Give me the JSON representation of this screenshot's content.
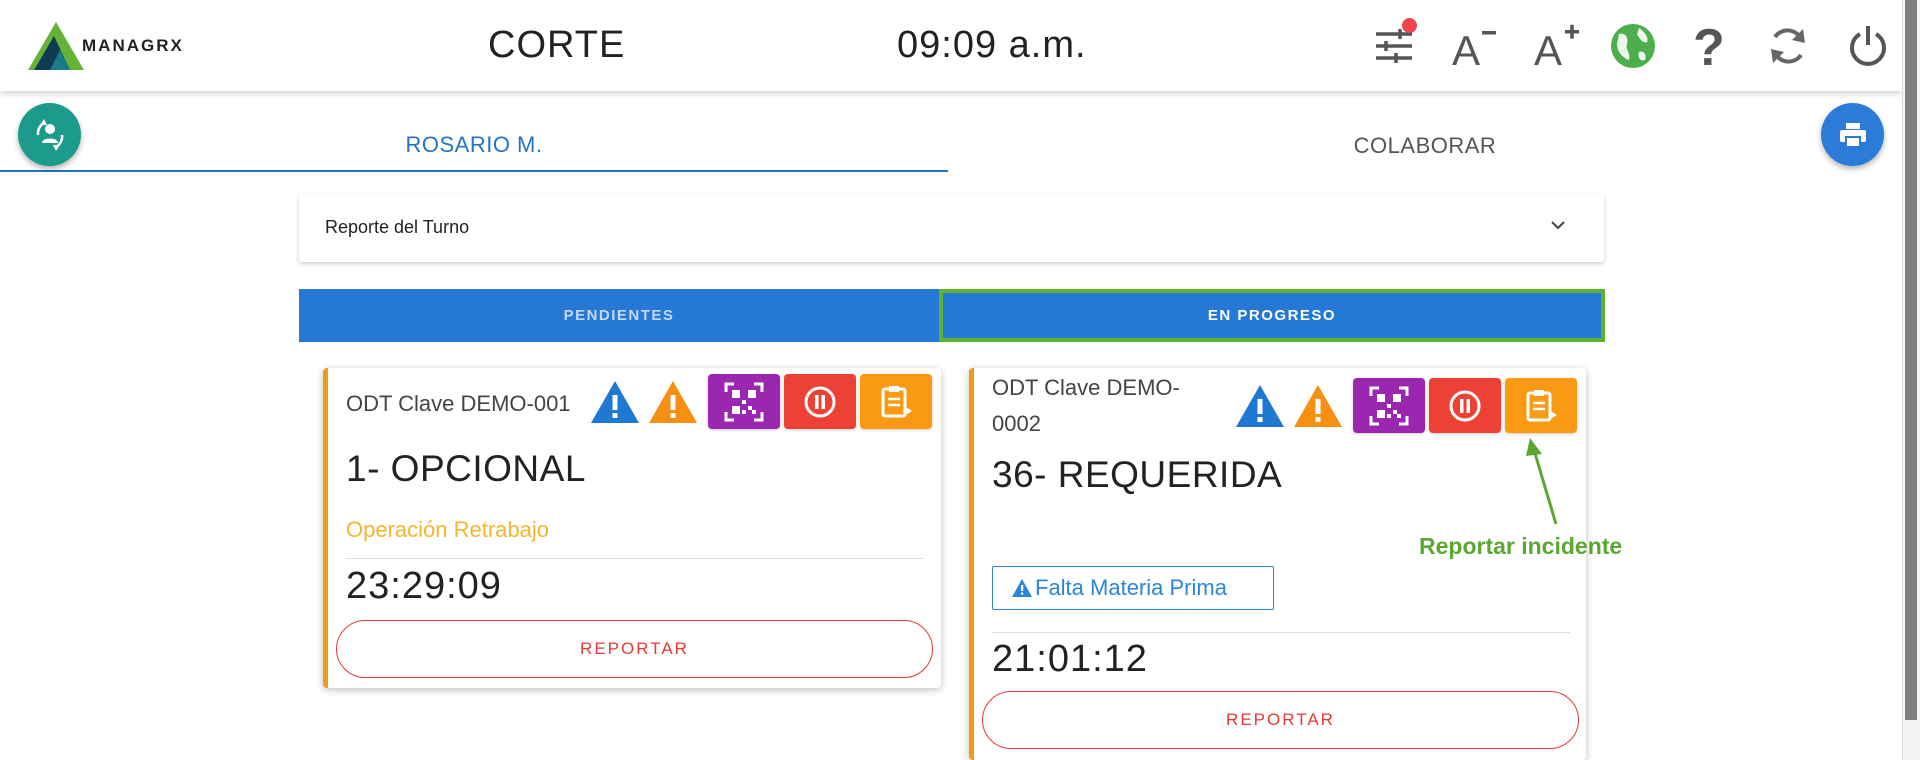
{
  "header": {
    "logo_text": "MANAGRX",
    "station": "CORTE",
    "clock": "09:09 a.m.",
    "icons": [
      "filters-icon",
      "font-decrease-icon",
      "font-increase-icon",
      "globe-icon",
      "help-icon",
      "refresh-icon",
      "power-icon"
    ]
  },
  "operator_tabs": [
    {
      "label": "ROSARIO M.",
      "active": true
    },
    {
      "label": "COLABORAR",
      "active": false
    }
  ],
  "report_panel": {
    "title": "Reporte del Turno"
  },
  "status_tabs": [
    {
      "label": "PENDIENTES",
      "active": false
    },
    {
      "label": "EN PROGRESO",
      "active": true
    }
  ],
  "cards": [
    {
      "id_label": "ODT Clave DEMO-001",
      "operation": "1- OPCIONAL",
      "subtitle": "Operación Retrabajo",
      "timer": "23:29:09",
      "report_label": "REPORTAR"
    },
    {
      "id_label_line1": "ODT Clave DEMO-",
      "id_label_line2": "0002",
      "operation": "36- REQUERIDA",
      "alert": "Falta Materia Prima",
      "timer": "21:01:12",
      "report_label": "REPORTAR"
    }
  ],
  "annotation": {
    "text": "Reportar incidente"
  },
  "colors": {
    "primary_blue": "#2578d6",
    "accent_orange": "#fa9a13",
    "purple": "#9b27b0",
    "red": "#ee4135",
    "green_annotation": "#5aa832",
    "teal": "#1c9a8c"
  }
}
